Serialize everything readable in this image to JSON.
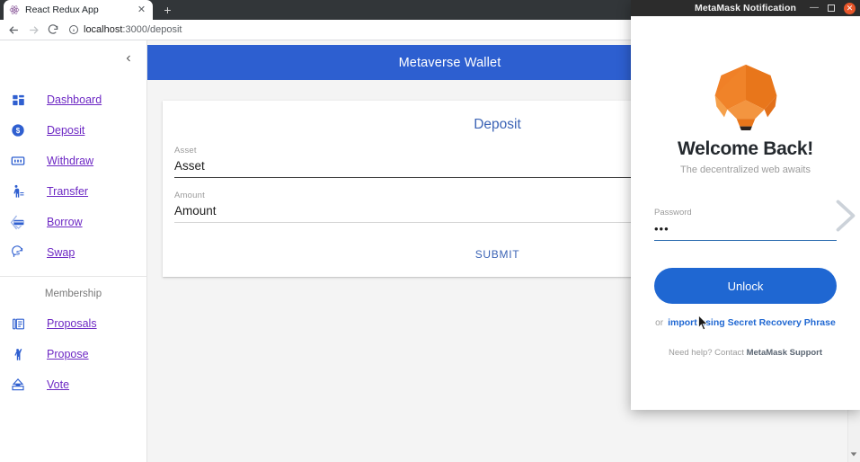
{
  "browser": {
    "tab": {
      "title": "React Redux App",
      "favicon_icon": "react-logo-icon",
      "close_icon": "close-icon"
    },
    "new_tab_icon": "plus-icon",
    "back_icon": "arrow-left-icon",
    "forward_icon": "arrow-right-icon",
    "reload_icon": "reload-icon",
    "omnibox": {
      "info_icon": "info-circle-icon",
      "host": "localhost",
      "path": ":3000/deposit",
      "full_url": "localhost:3000/deposit"
    }
  },
  "app": {
    "header": {
      "title": "Metaverse Wallet"
    },
    "sidebar": {
      "collapse_icon": "chevron-left-icon",
      "items": [
        {
          "label": "Dashboard",
          "icon": "dashboard-grid-icon"
        },
        {
          "label": "Deposit",
          "icon": "dollar-circle-icon"
        },
        {
          "label": "Withdraw",
          "icon": "banknote-icon"
        },
        {
          "label": "Transfer",
          "icon": "person-transfer-icon"
        },
        {
          "label": "Borrow",
          "icon": "card-arrow-left-icon"
        },
        {
          "label": "Swap",
          "icon": "swap-circle-icon"
        }
      ],
      "section_label": "Membership",
      "membership_items": [
        {
          "label": "Proposals",
          "icon": "documents-icon"
        },
        {
          "label": "Propose",
          "icon": "person-raise-hand-icon"
        },
        {
          "label": "Vote",
          "icon": "ballot-box-icon"
        }
      ]
    },
    "deposit_card": {
      "title": "Deposit",
      "fields": [
        {
          "label": "Asset",
          "placeholder": "Asset",
          "value": ""
        },
        {
          "label": "Amount",
          "placeholder": "Amount",
          "value": ""
        }
      ],
      "submit_label": "SUBMIT"
    }
  },
  "metamask": {
    "window_title": "MetaMask Notification",
    "minimize_icon": "minimize-icon",
    "maximize_icon": "maximize-icon",
    "close_icon": "close-icon",
    "logo_icon": "metamask-fox-icon",
    "heading": "Welcome Back!",
    "subtitle": "The decentralized web awaits",
    "password": {
      "label": "Password",
      "value": "•••",
      "chevron_icon": "chevron-right-icon"
    },
    "unlock_label": "Unlock",
    "or_text": "or",
    "import_link": "import using Secret Recovery Phrase",
    "help_prefix": "Need help? Contact ",
    "help_link": "MetaMask Support"
  },
  "colors": {
    "app_header_blue": "#2d5fd0",
    "unlock_blue": "#1f67d2",
    "link_purple": "#6d28c4",
    "icon_blue": "#2f5fd0",
    "metamask_orange": "#e8821e",
    "titlebar_dark": "#2c2c2c"
  }
}
